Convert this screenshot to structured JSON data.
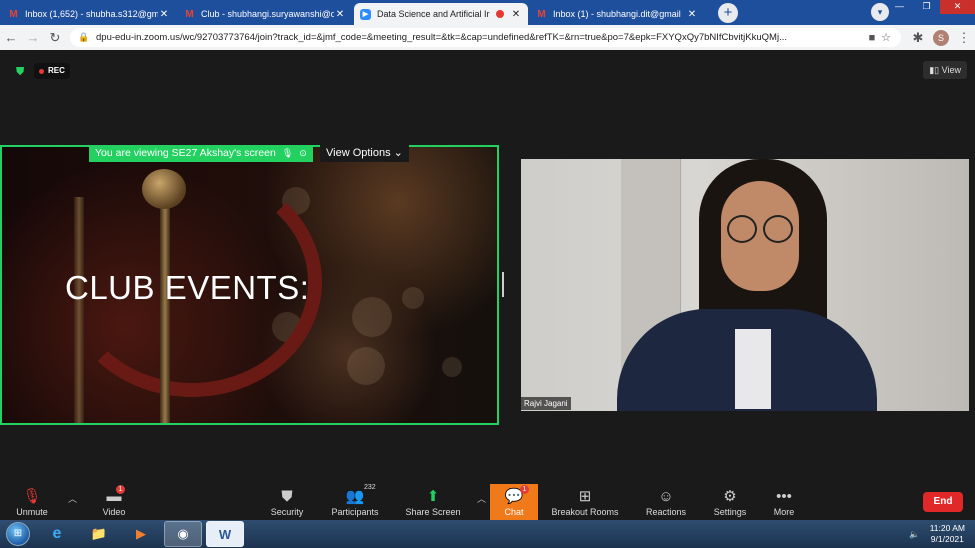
{
  "browser": {
    "tabs": [
      {
        "icon": "gmail-icon",
        "title": "Inbox (1,652) - shubha.s312@gm",
        "active": false
      },
      {
        "icon": "gmail-icon",
        "title": "Club - shubhangi.suryawanshi@d",
        "active": false
      },
      {
        "icon": "zoom-icon",
        "title": "Data Science and Artificial Ir",
        "active": true
      },
      {
        "icon": "gmail-icon",
        "title": "Inbox (1) - shubhangi.dit@gmail",
        "active": false
      }
    ],
    "new_tab": "+",
    "url": "dpu-edu-in.zoom.us/wc/92703773764/join?track_id=&jmf_code=&meeting_result=&tk=&cap=undefined&refTK=&rn=true&po=7&epk=FXYQxQy7bNIfCbvitjKkuQMj...",
    "profile_initial": "S"
  },
  "meeting": {
    "rec_label": "REC",
    "view_label": "View",
    "viewing_banner": "You are viewing SE27 Akshay's screen",
    "view_options_label": "View Options",
    "slide_text": "CLUB EVENTS:",
    "participant_name": "Rajvi Jagani"
  },
  "toolbar": {
    "unmute": "Unmute",
    "video": "Video",
    "video_badge": "1",
    "security": "Security",
    "participants": "Participants",
    "participants_count": "232",
    "share_screen": "Share Screen",
    "chat": "Chat",
    "chat_badge": "1",
    "breakout_rooms": "Breakout Rooms",
    "reactions": "Reactions",
    "settings": "Settings",
    "more": "More",
    "end": "End"
  },
  "taskbar": {
    "time": "11:20 AM",
    "date": "9/1/2021"
  },
  "colors": {
    "tab_strip": "#1e4f9c",
    "share_border": "#23d160",
    "chat_active": "#f07a1a",
    "end_button": "#e02828"
  }
}
